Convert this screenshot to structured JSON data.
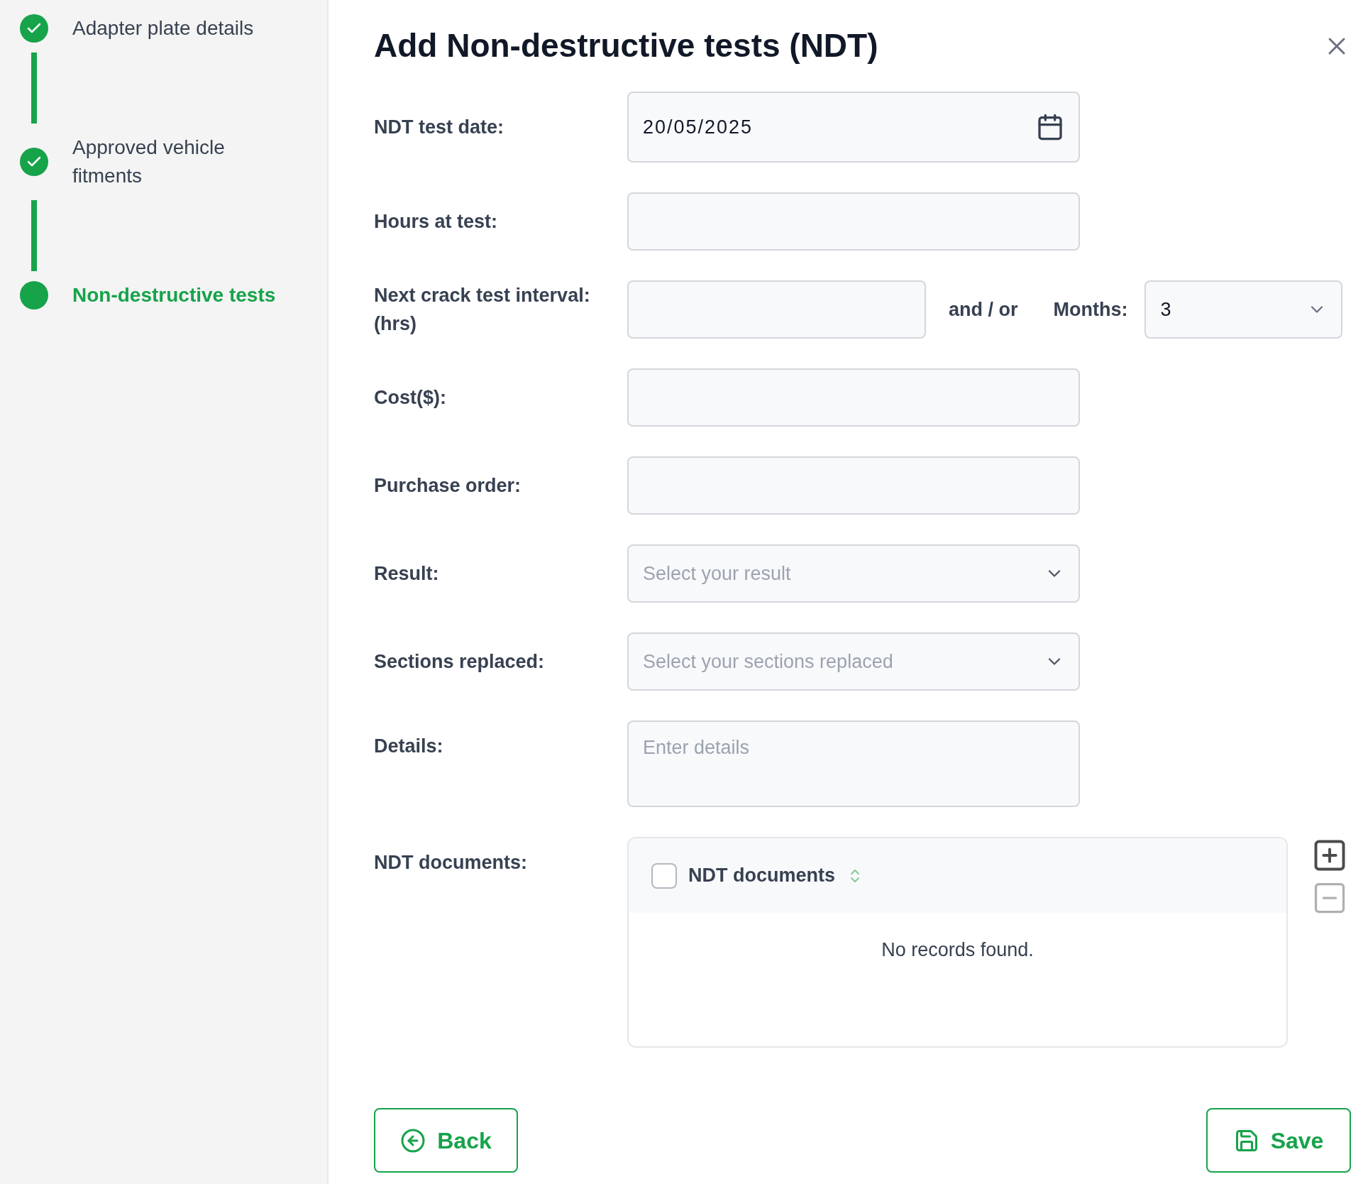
{
  "steps": [
    {
      "label": "Adapter plate details",
      "completed": true,
      "selected": false
    },
    {
      "label": "Approved vehicle fitments",
      "completed": true,
      "selected": false
    },
    {
      "label": "Non-destructive tests",
      "completed": false,
      "selected": true
    }
  ],
  "dialog": {
    "title": "Add Non-destructive tests (NDT)"
  },
  "fields": [
    {
      "kind": "date",
      "label": "NDT test date:",
      "value": "20/05/2025"
    },
    {
      "kind": "text",
      "label": "Hours at test:"
    },
    {
      "kind": "interval",
      "label": "Next crack test interval: (hrs)",
      "joiner": "and / or",
      "months_label": "Months:",
      "months_value": "3"
    },
    {
      "kind": "text",
      "label": "Cost($):"
    },
    {
      "kind": "text",
      "label": "Purchase order:"
    },
    {
      "kind": "select",
      "label": "Result:",
      "placeholder": "Select your result"
    },
    {
      "kind": "select",
      "label": "Sections replaced:",
      "placeholder": "Select your sections replaced"
    },
    {
      "kind": "textarea",
      "label": "Details:",
      "placeholder": "Enter details"
    },
    {
      "kind": "table",
      "label": "NDT documents:",
      "column": "NDT documents",
      "all_checked": false,
      "empty_text": "No records found."
    }
  ],
  "buttons": {
    "back": "Back",
    "save": "Save"
  }
}
